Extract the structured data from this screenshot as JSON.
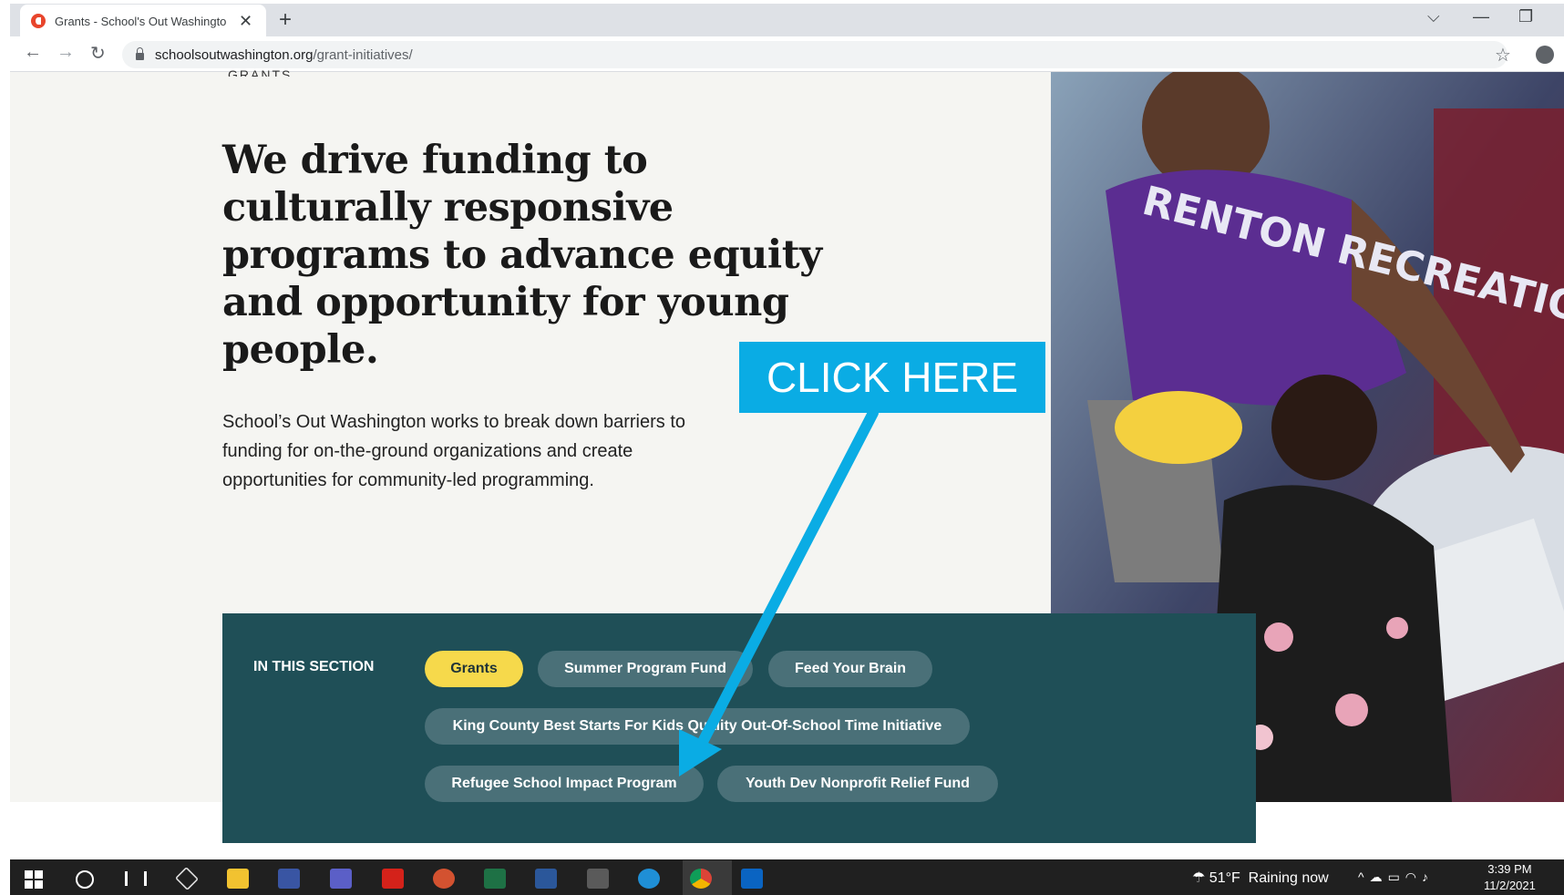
{
  "browser": {
    "tab_title": "Grants - School's Out Washingto",
    "tab_close": "✕",
    "new_tab": "+",
    "url_host": "schoolsoutwashington.org",
    "url_path": "/grant-initiatives/",
    "window_controls": [
      "⌵",
      "—",
      "❐"
    ],
    "nav": {
      "back": "←",
      "forward": "→",
      "reload": "↻"
    },
    "bookmark_icon": "☆"
  },
  "page": {
    "breadcrumb": "GRANTS",
    "headline": "We drive funding to culturally responsive programs to advance equity and opportunity for young people.",
    "intro": "School’s Out Washington works to break down barriers to funding for on-the-ground organizations and create opportunities for community-led programming.",
    "photo_alt": "RENTON RECREATION"
  },
  "section_nav": {
    "label": "IN THIS SECTION",
    "items": [
      {
        "label": "Grants",
        "active": true
      },
      {
        "label": "Summer Program Fund",
        "active": false
      },
      {
        "label": "Feed Your Brain",
        "active": false
      },
      {
        "label": "King County Best Starts For Kids Quality Out-Of-School Time Initiative",
        "active": false
      },
      {
        "label": "Refugee School Impact Program",
        "active": false
      },
      {
        "label": "Youth Dev Nonprofit Relief Fund",
        "active": false
      }
    ]
  },
  "annotation": {
    "callout_text": "CLICK HERE",
    "color": "#0aace4"
  },
  "taskbar": {
    "weather_temp": "51°F",
    "weather_text": "Raining now",
    "time": "3:39 PM",
    "date": "11/2/2021",
    "icons": [
      "start-icon",
      "search-icon",
      "task-view-icon",
      "3d-app-icon",
      "file-explorer-icon",
      "visio-icon",
      "teams-icon",
      "acrobat-icon",
      "powerpoint-icon",
      "excel-icon",
      "word-icon",
      "app-l-icon",
      "edge-icon",
      "chrome-icon",
      "outlook-icon"
    ]
  },
  "colors": {
    "section_bg": "#1f4f57",
    "pill_bg": "#4a7078",
    "pill_active": "#f6d94b",
    "hero_bg": "#f5f5f2"
  }
}
